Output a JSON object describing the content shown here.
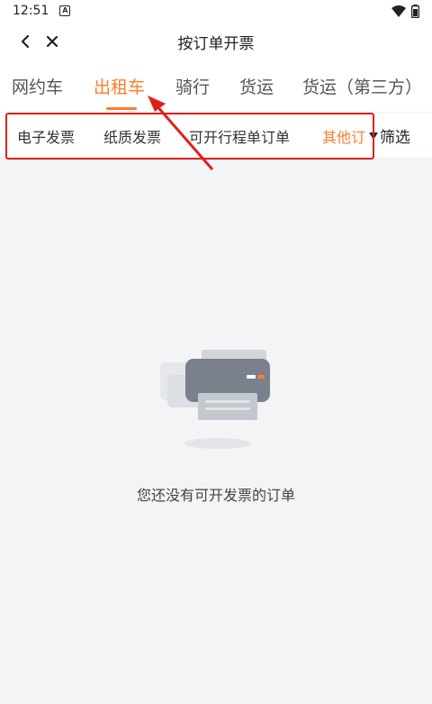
{
  "status": {
    "time": "12:51",
    "notification_icon": "A"
  },
  "header": {
    "title": "按订单开票"
  },
  "tabs": [
    {
      "label": "网约车"
    },
    {
      "label": "出租车"
    },
    {
      "label": "骑行"
    },
    {
      "label": "货运"
    },
    {
      "label": "货运（第三方）"
    }
  ],
  "subtabs": [
    {
      "label": "电子发票"
    },
    {
      "label": "纸质发票"
    },
    {
      "label": "可开行程单订单"
    },
    {
      "label": "其他订"
    }
  ],
  "filter": {
    "label": "筛选"
  },
  "empty_state": {
    "message": "您还没有可开发票的订单"
  },
  "colors": {
    "accent": "#ff7c2a",
    "annotation": "#e0201b",
    "background": "#f3f4f6"
  }
}
